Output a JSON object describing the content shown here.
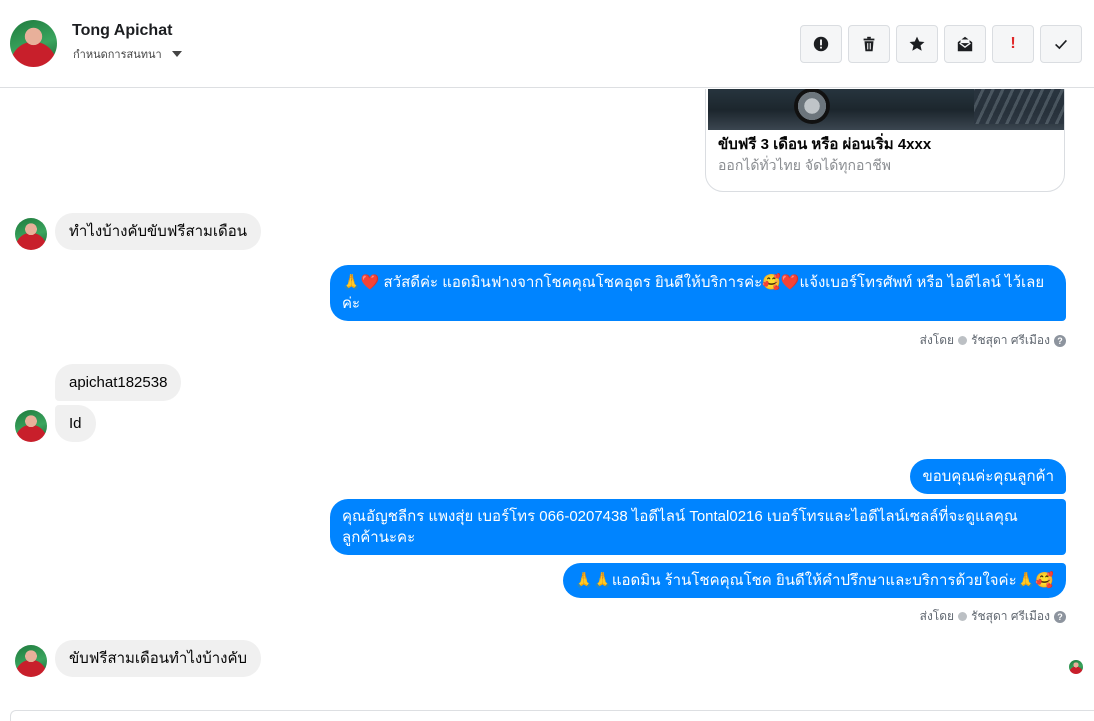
{
  "header": {
    "name": "Tong Apichat",
    "subtitle": "กำหนดการสนทนา",
    "toolbar": [
      {
        "icon": "alert-circle-icon",
        "label": ""
      },
      {
        "icon": "trash-icon",
        "label": ""
      },
      {
        "icon": "star-icon",
        "label": ""
      },
      {
        "icon": "mark-unread-icon",
        "label": ""
      },
      {
        "icon": "important-icon",
        "label": "!"
      },
      {
        "icon": "checkmark-icon",
        "label": ""
      }
    ]
  },
  "link_card": {
    "title": "ขับฟรี 3 เดือน หรือ ผ่อนเริ่ม 4xxx",
    "subtitle": "ออกได้ทั่วไทย จัดได้ทุกอาชีพ"
  },
  "messages": [
    {
      "dir": "in",
      "text": "ทำไงบ้างคับขับฟรีสามเดือน"
    },
    {
      "dir": "out",
      "text": "🙏❤️ สวัสดีค่ะ แอดมินฟางจากโชคคุณโชคอุดร ยินดีให้บริการค่ะ🥰❤️แจ้งเบอร์โทรศัพท์ หรือ ไอดีไลน์  ไว้เลยค่ะ"
    },
    {
      "dir": "in",
      "text": "apichat182538"
    },
    {
      "dir": "in",
      "text": "Id"
    },
    {
      "dir": "out",
      "text": "ขอบคุณค่ะคุณลูกค้า"
    },
    {
      "dir": "out",
      "text": "คุณอัญชลีกร แพงสุ่ย      เบอร์โทร 066-0207438 ไอดีไลน์ Tontal0216   เบอร์โทรและไอดีไลน์เซลล์ที่จะดูแลคุณลูกค้านะคะ"
    },
    {
      "dir": "out",
      "text": "🙏🙏แอดมิน ร้านโชคคุณโชค ยินดีให้คำปรึกษาและบริการด้วยใจค่ะ🙏🥰"
    },
    {
      "dir": "in",
      "text": "ขับฟรีสามเดือนทำไงบ้างคับ"
    }
  ],
  "sent_by": {
    "prefix": "ส่งโดย",
    "agent": "รัชสุดา ศรีเมือง",
    "help": "?"
  },
  "colors": {
    "outgoing": "#0084ff",
    "incoming": "#f0f0f0"
  }
}
